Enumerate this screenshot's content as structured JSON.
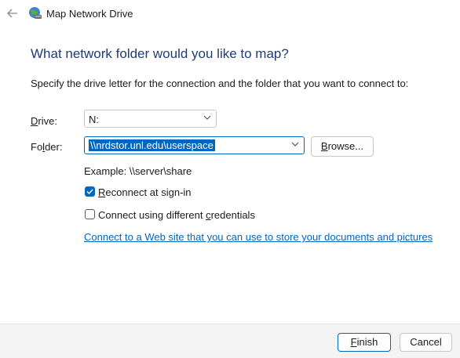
{
  "window": {
    "title": "Map Network Drive",
    "back_icon": "back-arrow-icon",
    "app_icon": "network-drive-icon"
  },
  "main": {
    "heading": "What network folder would you like to map?",
    "instructions": "Specify the drive letter for the connection and the folder that you want to connect to:",
    "drive": {
      "label_access": "D",
      "label_rest": "rive:",
      "value": "N:"
    },
    "folder": {
      "label_pre": "Fo",
      "label_access": "l",
      "label_rest": "der:",
      "value": "\\\\nrdstor.unl.edu\\userspace"
    },
    "browse": {
      "label_access": "B",
      "label_rest": "rowse..."
    },
    "example": "Example: \\\\server\\share",
    "reconnect": {
      "checked": true,
      "label_access": "R",
      "label_rest": "econnect at sign-in"
    },
    "credentials": {
      "checked": false,
      "label_pre": "Connect using different ",
      "label_access": "c",
      "label_rest": "redentials"
    },
    "web_link": "Connect to a Web site that you can use to store your documents and pictures",
    "web_link_suffix": "."
  },
  "footer": {
    "finish": {
      "label_access": "F",
      "label_rest": "inish"
    },
    "cancel_label": "Cancel"
  },
  "colors": {
    "accent": "#0067c0",
    "heading": "#1f3b7a",
    "footer_bg": "#f3f3f3"
  }
}
